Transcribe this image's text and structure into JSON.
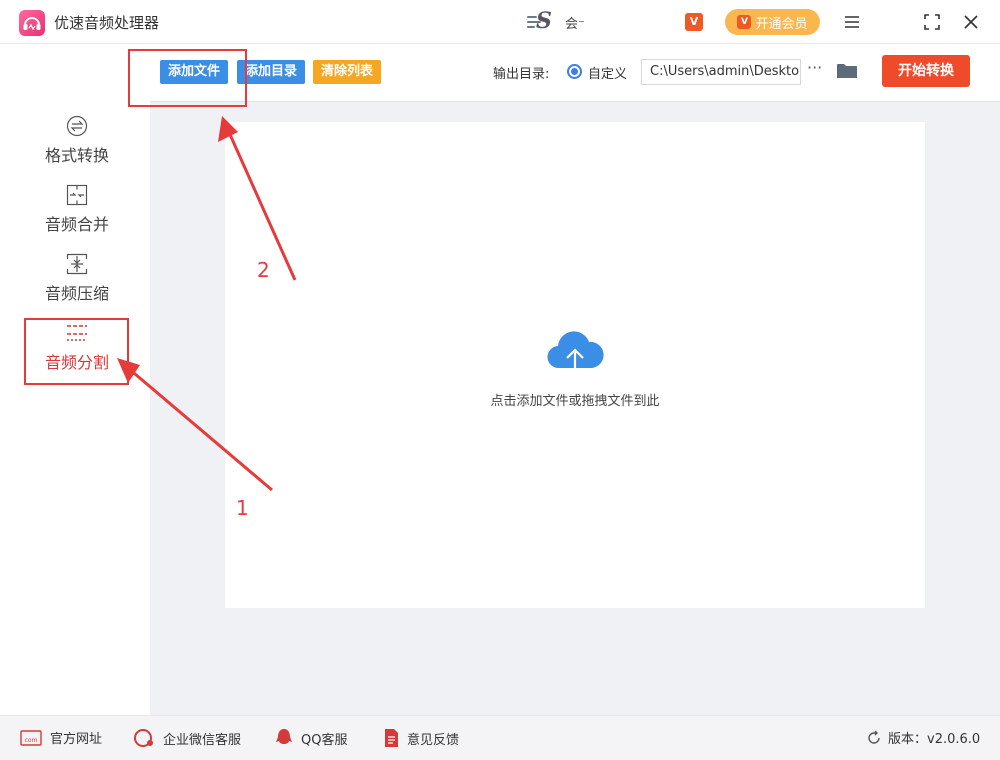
{
  "app": {
    "title": "优速音频处理器",
    "user_name": "会⁻",
    "vip_badge_text": "V",
    "vip_button_label": "开通会员",
    "brand_color": "#e8306f"
  },
  "window_controls": {
    "menu_icon": "≡",
    "maximize_icon": "⛶",
    "close_icon": "✕"
  },
  "sidebar": {
    "items": [
      {
        "label": "格式转换",
        "icon": "convert-icon"
      },
      {
        "label": "音频合并",
        "icon": "merge-icon"
      },
      {
        "label": "音频压缩",
        "icon": "compress-icon"
      },
      {
        "label": "音频分割",
        "icon": "split-icon",
        "active": true
      }
    ]
  },
  "toolbar": {
    "add_file": "添加文件",
    "add_folder": "添加目录",
    "clear_list": "清除列表",
    "output_label": "输出目录:",
    "custom_option": "自定义",
    "output_path": "C:\\Users\\admin\\Deskto",
    "more_label": "···",
    "start_label": "开始转换",
    "colors": {
      "add_file": "#3a8ee6",
      "add_folder": "#3a8ee6",
      "clear_list": "#f5a623",
      "start": "#ef4b2b"
    }
  },
  "dropzone": {
    "hint": "点击添加文件或拖拽文件到此"
  },
  "annotations": {
    "step1": "1",
    "step2": "2",
    "color": "#e53b3b"
  },
  "footer": {
    "website": "官方网址",
    "wechat": "企业微信客服",
    "qq": "QQ客服",
    "feedback": "意见反馈",
    "version": "版本：v2.0.6.0"
  }
}
